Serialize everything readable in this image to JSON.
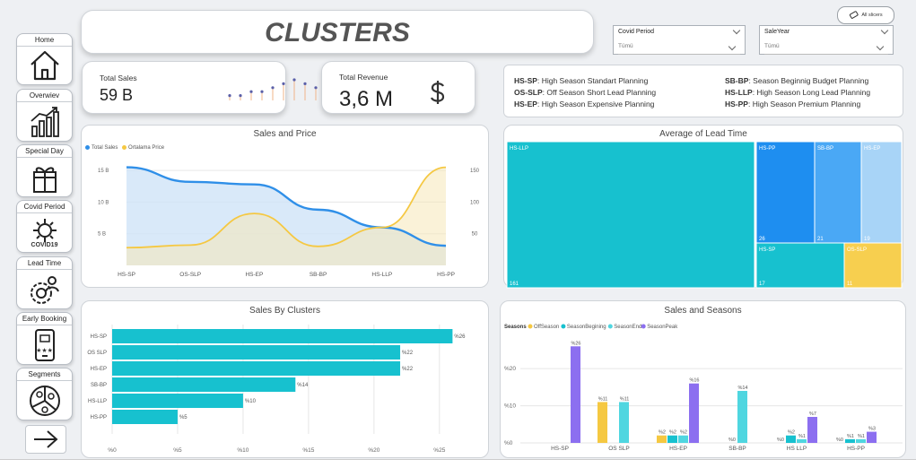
{
  "header": {
    "title": "CLUSTERS"
  },
  "clear_button": {
    "label": "All slicers"
  },
  "nav": [
    {
      "label": "Home",
      "icon": "home-icon"
    },
    {
      "label": "Overwiev",
      "icon": "bar-chart-icon"
    },
    {
      "label": "Special Day",
      "icon": "gift-box-icon"
    },
    {
      "label": "Covid Period",
      "icon": "covid-icon",
      "sub": "COVID19"
    },
    {
      "label": "Lead Time",
      "icon": "clock-gear-icon"
    },
    {
      "label": "Early Booking",
      "icon": "phone-rating-icon",
      "sub": "★★★"
    },
    {
      "label": "Segments",
      "icon": "segments-icon"
    }
  ],
  "slicers": [
    {
      "title": "Covid Period",
      "value": "Tümü"
    },
    {
      "title": "SaleYear",
      "value": "Tümü"
    }
  ],
  "kpis": {
    "total_sales": {
      "label": "Total Sales",
      "value": "59 B"
    },
    "total_revenue": {
      "label": "Total Revenue",
      "value": "3,6 M",
      "icon": "dollar-icon"
    }
  },
  "cluster_legend": [
    {
      "code": "HS-SP",
      "text": ": High Season Standart Planning"
    },
    {
      "code": "OS-SLP",
      "text": ": Off Season Short Lead Planning"
    },
    {
      "code": "HS-EP",
      "text": ": High Season Expensive Planning"
    },
    {
      "code": "SB-BP",
      "text": ": Season Beginnig Budget Planning"
    },
    {
      "code": "HS-LLP",
      "text": ": High Season Long Lead Planning"
    },
    {
      "code": "HS-PP",
      "text": ": High Season Premium Planning"
    }
  ],
  "colors": {
    "blue": "#2f8fe8",
    "yellow": "#f5c842",
    "teal": "#17c1cf",
    "purple": "#8c6ff0",
    "lightblue": "#a8d4f7"
  },
  "chart_data": [
    {
      "type": "area",
      "title": "Sales and Price",
      "categories": [
        "HS-SP",
        "OS-SLP",
        "HS-EP",
        "SB-BP",
        "HS-LLP",
        "HS-PP"
      ],
      "series": [
        {
          "name": "Total Sales",
          "axis": "left",
          "values": [
            15.5,
            13.2,
            12.8,
            8.8,
            6.0,
            3.1
          ]
        },
        {
          "name": "Ortalama Price",
          "axis": "right",
          "values": [
            28,
            32,
            82,
            30,
            60,
            155
          ]
        }
      ],
      "y_left": {
        "ticks": [
          "15 B",
          "10 B",
          "5 B"
        ],
        "ylim": [
          0,
          17
        ]
      },
      "y_right": {
        "ticks": [
          "150",
          "100",
          "50"
        ],
        "ylim": [
          0,
          170
        ]
      }
    },
    {
      "type": "treemap",
      "title": "Average of Lead Time",
      "items": [
        {
          "label": "HS-LLP",
          "value": "161",
          "color": "#17c1cf"
        },
        {
          "label": "HS-PP",
          "value": "26",
          "color": "#1e8ef0"
        },
        {
          "label": "SB-BP",
          "value": "21",
          "color": "#4aa8f5"
        },
        {
          "label": "HS-EP",
          "value": "19",
          "color": "#a8d4f7"
        },
        {
          "label": "HS-SP",
          "value": "17",
          "color": "#17c1cf"
        },
        {
          "label": "OS-SLP",
          "value": "11",
          "color": "#f7cf4f"
        }
      ]
    },
    {
      "type": "bar",
      "title": "Sales By Clusters",
      "categories": [
        "HS-SP",
        "OS SLP",
        "HS-EP",
        "SB-BP",
        "HS-LLP",
        "HS-PP"
      ],
      "values": [
        26,
        22,
        22,
        14,
        10,
        5
      ],
      "labels": [
        "%26",
        "%22",
        "%22",
        "%14",
        "%10",
        "%5"
      ],
      "x_ticks": [
        "%0",
        "%5",
        "%10",
        "%15",
        "%20",
        "%25"
      ],
      "xlim": [
        0,
        27
      ]
    },
    {
      "type": "bar",
      "title": "Sales and Seasons",
      "legend_title": "Seasons",
      "categories": [
        "HS-SP",
        "OS SLP",
        "HS-EP",
        "SB-BP",
        "HS LLP",
        "HS-PP"
      ],
      "series": [
        {
          "name": "OffSeason",
          "color": "#f5c842",
          "values": [
            0,
            11,
            2,
            0,
            0,
            0
          ],
          "labels": [
            "",
            "%11",
            "%2",
            "",
            "%0",
            "%0"
          ]
        },
        {
          "name": "SeasonBegining",
          "color": "#17c1cf",
          "values": [
            0,
            0,
            2,
            0,
            2,
            1
          ],
          "labels": [
            "",
            "",
            "%2",
            "%0",
            "%2",
            "%1"
          ]
        },
        {
          "name": "SeasonEnd",
          "color": "#4fd6e0",
          "values": [
            0,
            11,
            2,
            14,
            1,
            1
          ],
          "labels": [
            "",
            "%11",
            "%2",
            "%14",
            "%1",
            "%1"
          ]
        },
        {
          "name": "SeasonPeak",
          "color": "#8c6ff0",
          "values": [
            26,
            0,
            16,
            0,
            7,
            3
          ],
          "labels": [
            "%26",
            "",
            "%16",
            "",
            "%7",
            "%3"
          ]
        }
      ],
      "y_ticks": [
        "%20",
        "%10",
        "%0"
      ],
      "ylim": [
        0,
        28
      ]
    }
  ],
  "sparkline": [
    1,
    1,
    2,
    2,
    3,
    4,
    5,
    4,
    3,
    2,
    1,
    1
  ]
}
